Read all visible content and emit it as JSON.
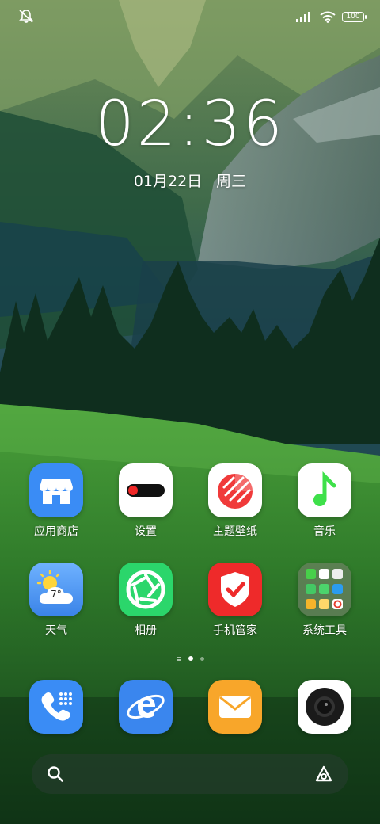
{
  "status_bar": {
    "battery": "100",
    "icons": [
      "silent-mode-icon",
      "signal-icon",
      "wifi-icon",
      "battery-icon"
    ]
  },
  "lock": {
    "time": "02:36",
    "date": "01月22日",
    "weekday": "周三"
  },
  "apps_row1": [
    {
      "label": "应用商店",
      "icon": "app-store-icon",
      "color": "#3a8cf5"
    },
    {
      "label": "设置",
      "icon": "settings-icon",
      "color": "#ffffff"
    },
    {
      "label": "主题壁纸",
      "icon": "theme-icon",
      "color": "#ffffff"
    },
    {
      "label": "音乐",
      "icon": "music-icon",
      "color": "#ffffff"
    }
  ],
  "apps_row2": [
    {
      "label": "天气",
      "icon": "weather-icon",
      "color": "#4a90f0"
    },
    {
      "label": "相册",
      "icon": "gallery-icon",
      "color": "#2bd66b"
    },
    {
      "label": "手机管家",
      "icon": "phone-manager-icon",
      "color": "#ee2a2a"
    },
    {
      "label": "系统工具",
      "icon": "folder-icon",
      "color": "#5a6a4a"
    }
  ],
  "weather_temp": "7°",
  "page_indicator": {
    "count": 2,
    "active": 0
  },
  "dock": [
    {
      "icon": "phone-icon",
      "color": "#3a8cf5"
    },
    {
      "icon": "browser-icon",
      "color": "#3a86ee"
    },
    {
      "icon": "email-icon",
      "color": "#f8a62a"
    },
    {
      "icon": "camera-icon",
      "color": "#ffffff"
    }
  ],
  "search": {
    "placeholder": ""
  }
}
